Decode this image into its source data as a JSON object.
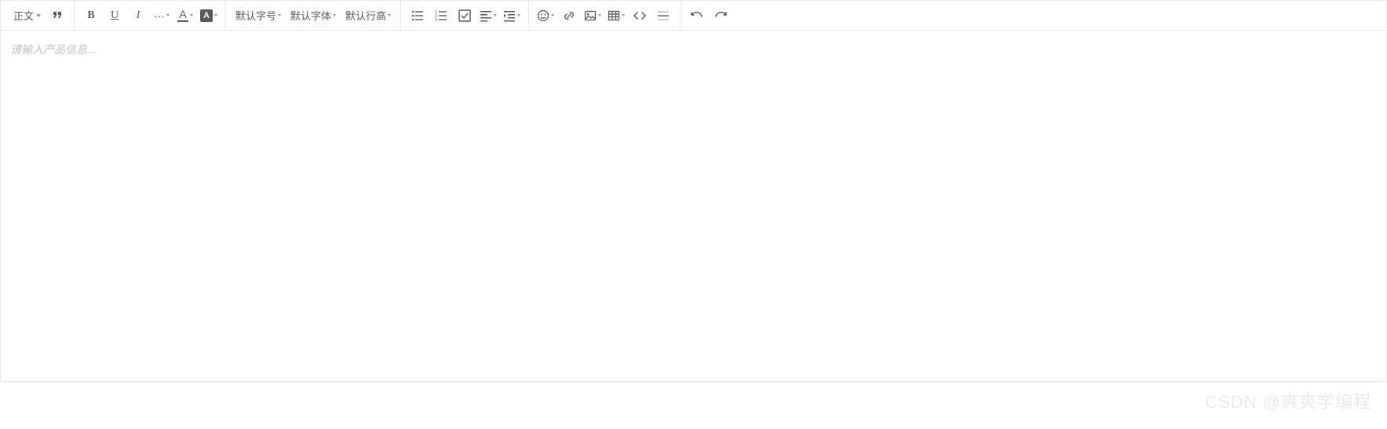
{
  "toolbar": {
    "heading_label": "正文",
    "font_size_label": "默认字号",
    "font_family_label": "默认字体",
    "line_height_label": "默认行高",
    "bold_char": "B",
    "underline_char": "U",
    "italic_char": "I",
    "more_char": "···",
    "font_color_char": "A",
    "bg_color_char": "A"
  },
  "editor": {
    "placeholder": "请输入产品信息..."
  },
  "watermark": "CSDN @爽爽学编程"
}
